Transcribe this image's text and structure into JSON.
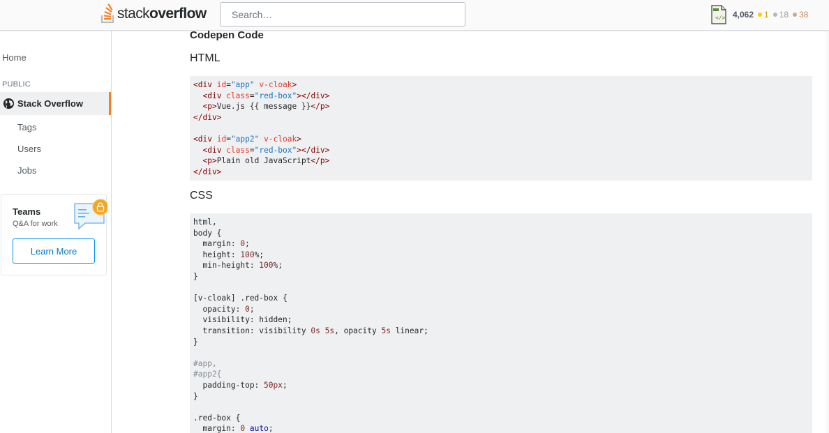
{
  "topbar": {
    "logo": {
      "light": "stack",
      "bold": "overflow"
    },
    "search_placeholder": "Search…",
    "user": {
      "reputation": "4,062",
      "gold": "1",
      "silver": "18",
      "bronze": "38"
    },
    "colors": {
      "brand": "#f48024",
      "gold": "#ffcc01",
      "silver": "#b4b8bc",
      "bronze": "#d1a684"
    }
  },
  "sidebar": {
    "home": "Home",
    "section": "PUBLIC",
    "active": "Stack Overflow",
    "items": [
      "Tags",
      "Users",
      "Jobs"
    ],
    "teams": {
      "title": "Teams",
      "subtitle": "Q&A for work",
      "button": "Learn More"
    }
  },
  "main": {
    "heading": "Codepen Code",
    "sections": [
      {
        "title": "HTML"
      },
      {
        "title": "CSS"
      }
    ]
  }
}
